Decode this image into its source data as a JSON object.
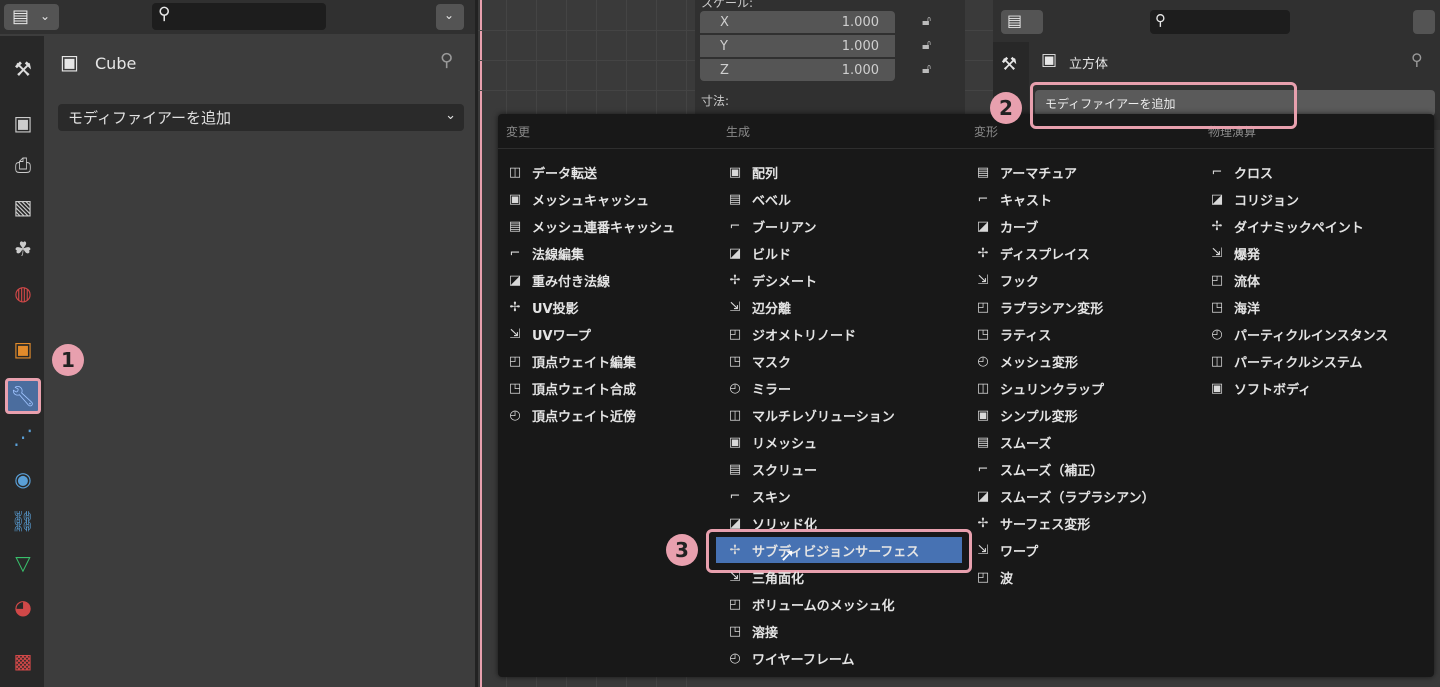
{
  "left_panel": {
    "object_name": "Cube",
    "add_modifier_label": "モディファイアーを追加",
    "tabs": [
      "tool",
      "render",
      "output",
      "view-layer",
      "scene",
      "world",
      "object",
      "modifiers",
      "particles",
      "physics",
      "constraints",
      "data",
      "material",
      "texture"
    ]
  },
  "transform": {
    "header_partial": "スケール:",
    "rows": [
      {
        "axis": "X",
        "value": "1.000"
      },
      {
        "axis": "Y",
        "value": "1.000"
      },
      {
        "axis": "Z",
        "value": "1.000"
      }
    ],
    "dimensions_label": "寸法:"
  },
  "right_panel": {
    "object_name": "立方体",
    "add_modifier_label": "モディファイアーを追加"
  },
  "menu": {
    "columns": [
      {
        "header": "変更",
        "items": [
          "データ転送",
          "メッシュキャッシュ",
          "メッシュ連番キャッシュ",
          "法線編集",
          "重み付き法線",
          "UV投影",
          "UVワープ",
          "頂点ウェイト編集",
          "頂点ウェイト合成",
          "頂点ウェイト近傍"
        ]
      },
      {
        "header": "生成",
        "items": [
          "配列",
          "ベベル",
          "ブーリアン",
          "ビルド",
          "デシメート",
          "辺分離",
          "ジオメトリノード",
          "マスク",
          "ミラー",
          "マルチレゾリューション",
          "リメッシュ",
          "スクリュー",
          "スキン",
          "ソリッド化",
          "サブディビジョンサーフェス",
          "三角面化",
          "ボリュームのメッシュ化",
          "溶接",
          "ワイヤーフレーム"
        ]
      },
      {
        "header": "変形",
        "items": [
          "アーマチュア",
          "キャスト",
          "カーブ",
          "ディスプレイス",
          "フック",
          "ラプラシアン変形",
          "ラティス",
          "メッシュ変形",
          "シュリンクラップ",
          "シンプル変形",
          "スムーズ",
          "スムーズ（補正）",
          "スムーズ（ラプラシアン）",
          "サーフェス変形",
          "ワープ",
          "波"
        ]
      },
      {
        "header": "物理演算",
        "items": [
          "クロス",
          "コリジョン",
          "ダイナミックペイント",
          "爆発",
          "流体",
          "海洋",
          "パーティクルインスタンス",
          "パーティクルシステム",
          "ソフトボディ"
        ]
      }
    ],
    "highlighted": "サブディビジョンサーフェス"
  },
  "callouts": [
    "1",
    "2",
    "3"
  ],
  "colors": {
    "accent": "#4772b3",
    "callout": "#e8a0ae",
    "menu_bg": "#181818"
  }
}
